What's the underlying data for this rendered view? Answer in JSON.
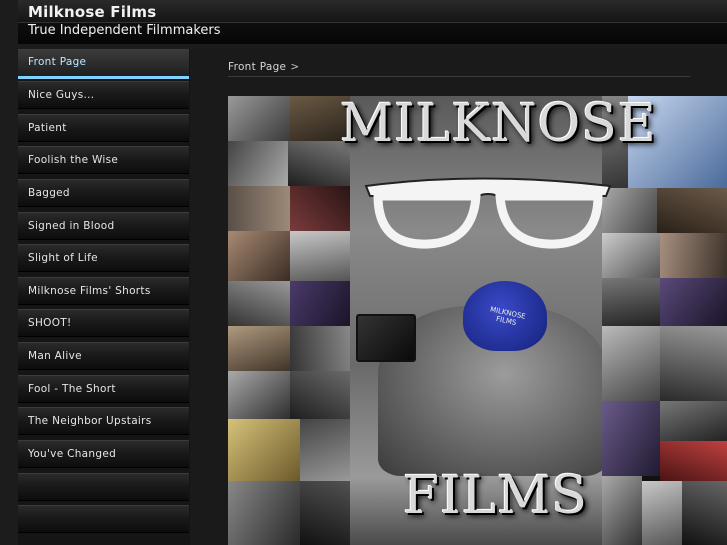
{
  "site": {
    "title": "Milknose Films",
    "tagline": "True Independent Filmmakers"
  },
  "nav": {
    "items": [
      {
        "label": "Front Page",
        "active": true
      },
      {
        "label": "Nice Guys..."
      },
      {
        "label": "Patient"
      },
      {
        "label": "Foolish the Wise"
      },
      {
        "label": "Bagged"
      },
      {
        "label": "Signed in Blood"
      },
      {
        "label": "Slight of Life"
      },
      {
        "label": "Milknose Films' Shorts"
      },
      {
        "label": "SHOOT!"
      },
      {
        "label": "Man Alive"
      },
      {
        "label": "Fool - The Short"
      },
      {
        "label": "The Neighbor Upstairs"
      },
      {
        "label": "You've Changed"
      },
      {
        "label": ""
      },
      {
        "label": ""
      }
    ]
  },
  "breadcrumb": {
    "current": "Front Page",
    "separator": ">"
  },
  "poster": {
    "top_word": "MILKNOSE",
    "bottom_word": "FILMS",
    "cap_text_line1": "MILKNOSE",
    "cap_text_line2": "FILMS"
  },
  "colors": {
    "accent": "#7fd2ff",
    "background": "#1c1c1c",
    "cap": "#2f3fb0"
  }
}
